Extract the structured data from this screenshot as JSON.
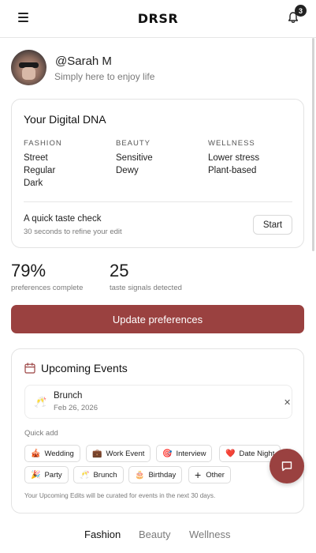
{
  "header": {
    "logo": "DRSR",
    "notifications_count": "3",
    "icons": [
      "menu-icon",
      "bell-icon"
    ]
  },
  "profile": {
    "handle": "@Sarah M",
    "bio": "Simply here to enjoy life"
  },
  "dna": {
    "title": "Your Digital DNA",
    "columns": [
      {
        "heading": "FASHION",
        "values": [
          "Street",
          "Regular",
          "Dark"
        ]
      },
      {
        "heading": "BEAUTY",
        "values": [
          "Sensitive",
          "Dewy"
        ]
      },
      {
        "heading": "WELLNESS",
        "values": [
          "Lower stress",
          "Plant-based"
        ]
      }
    ],
    "taste_check": {
      "title": "A quick taste check",
      "subtitle": "30 seconds to refine your edit",
      "button": "Start"
    }
  },
  "stats": [
    {
      "value": "79%",
      "label": "preferences complete"
    },
    {
      "value": "25",
      "label": "taste signals detected"
    }
  ],
  "update_button": "Update preferences",
  "events": {
    "title": "Upcoming Events",
    "items": [
      {
        "emoji": "🥂",
        "name": "Brunch",
        "date": "Feb 26, 2026"
      }
    ],
    "quick_add_label": "Quick add",
    "quick_add": [
      {
        "icon": "🎪",
        "label": "Wedding"
      },
      {
        "icon": "💼",
        "label": "Work Event"
      },
      {
        "icon": "🎯",
        "label": "Interview"
      },
      {
        "icon": "❤️",
        "label": "Date Night"
      },
      {
        "icon": "🎉",
        "label": "Party"
      },
      {
        "icon": "🥂",
        "label": "Brunch"
      },
      {
        "icon": "🎂",
        "label": "Birthday"
      },
      {
        "icon": "+",
        "label": "Other"
      }
    ],
    "note": "Your Upcoming Edits will be curated for events in the next 30 days."
  },
  "tabs": [
    {
      "label": "Fashion",
      "active": true
    },
    {
      "label": "Beauty",
      "active": false
    },
    {
      "label": "Wellness",
      "active": false
    }
  ],
  "colors": {
    "accent": "#9a4140",
    "text": "#1f1f1f",
    "muted": "#7a7a7a",
    "border": "#e3e3e3"
  }
}
